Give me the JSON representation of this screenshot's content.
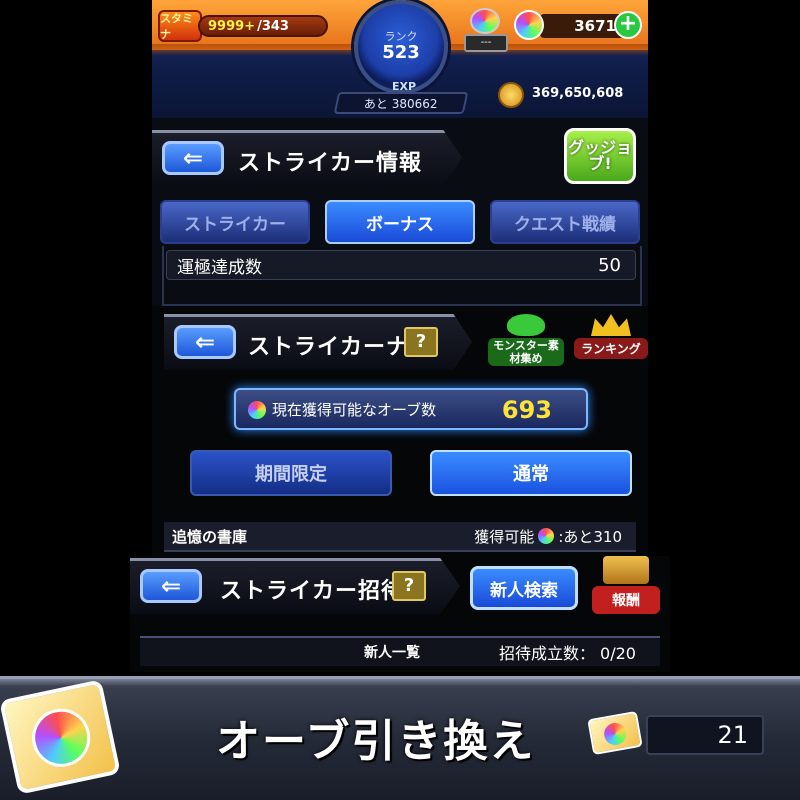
{
  "status": {
    "stamina_label": "スタミナ",
    "stamina_current": "9999+",
    "stamina_max": "/343",
    "rank_label": "ランク",
    "rank_value": "523",
    "exp_label": "EXP",
    "exp_remaining": "あと 380662",
    "gacha_count": "---",
    "orb_count": "3671",
    "add_orbs": "+",
    "gold": "369,650,608"
  },
  "striker_info": {
    "title": "ストライカー情報",
    "back": "⇐",
    "good_job": "グッジョブ!",
    "tabs": [
      {
        "label": "ストライカー",
        "active": false
      },
      {
        "label": "ボーナス",
        "active": true
      },
      {
        "label": "クエスト戦績",
        "active": false
      }
    ],
    "luck_row": {
      "label": "運極達成数",
      "value": "50"
    }
  },
  "striker_navi": {
    "title": "ストライカーナビ",
    "back": "⇐",
    "help": "?",
    "monster_badge": "モンスター素材集め",
    "ranking_badge": "ランキング",
    "orb_available_label": "現在獲得可能なオーブ数",
    "orb_available_value": "693",
    "modes": [
      {
        "label": "期間限定",
        "active": false
      },
      {
        "label": "通常",
        "active": true
      }
    ],
    "memory": {
      "label": "追憶の書庫",
      "obtainable": "獲得可能",
      "remaining": ":あと310"
    }
  },
  "striker_invite": {
    "title": "ストライカー招待",
    "back": "⇐",
    "help": "?",
    "search_button": "新人検索",
    "reward": "報酬",
    "newbie_list": "新人一覧",
    "success_count": "招待成立数： 0/20"
  },
  "exchange": {
    "title": "オーブ引き換え",
    "ticket_count": "21"
  },
  "colors": {
    "accent_blue": "#1a4ad8",
    "orb_gold": "#ffe23a",
    "top_orange": "#ffa53a"
  }
}
